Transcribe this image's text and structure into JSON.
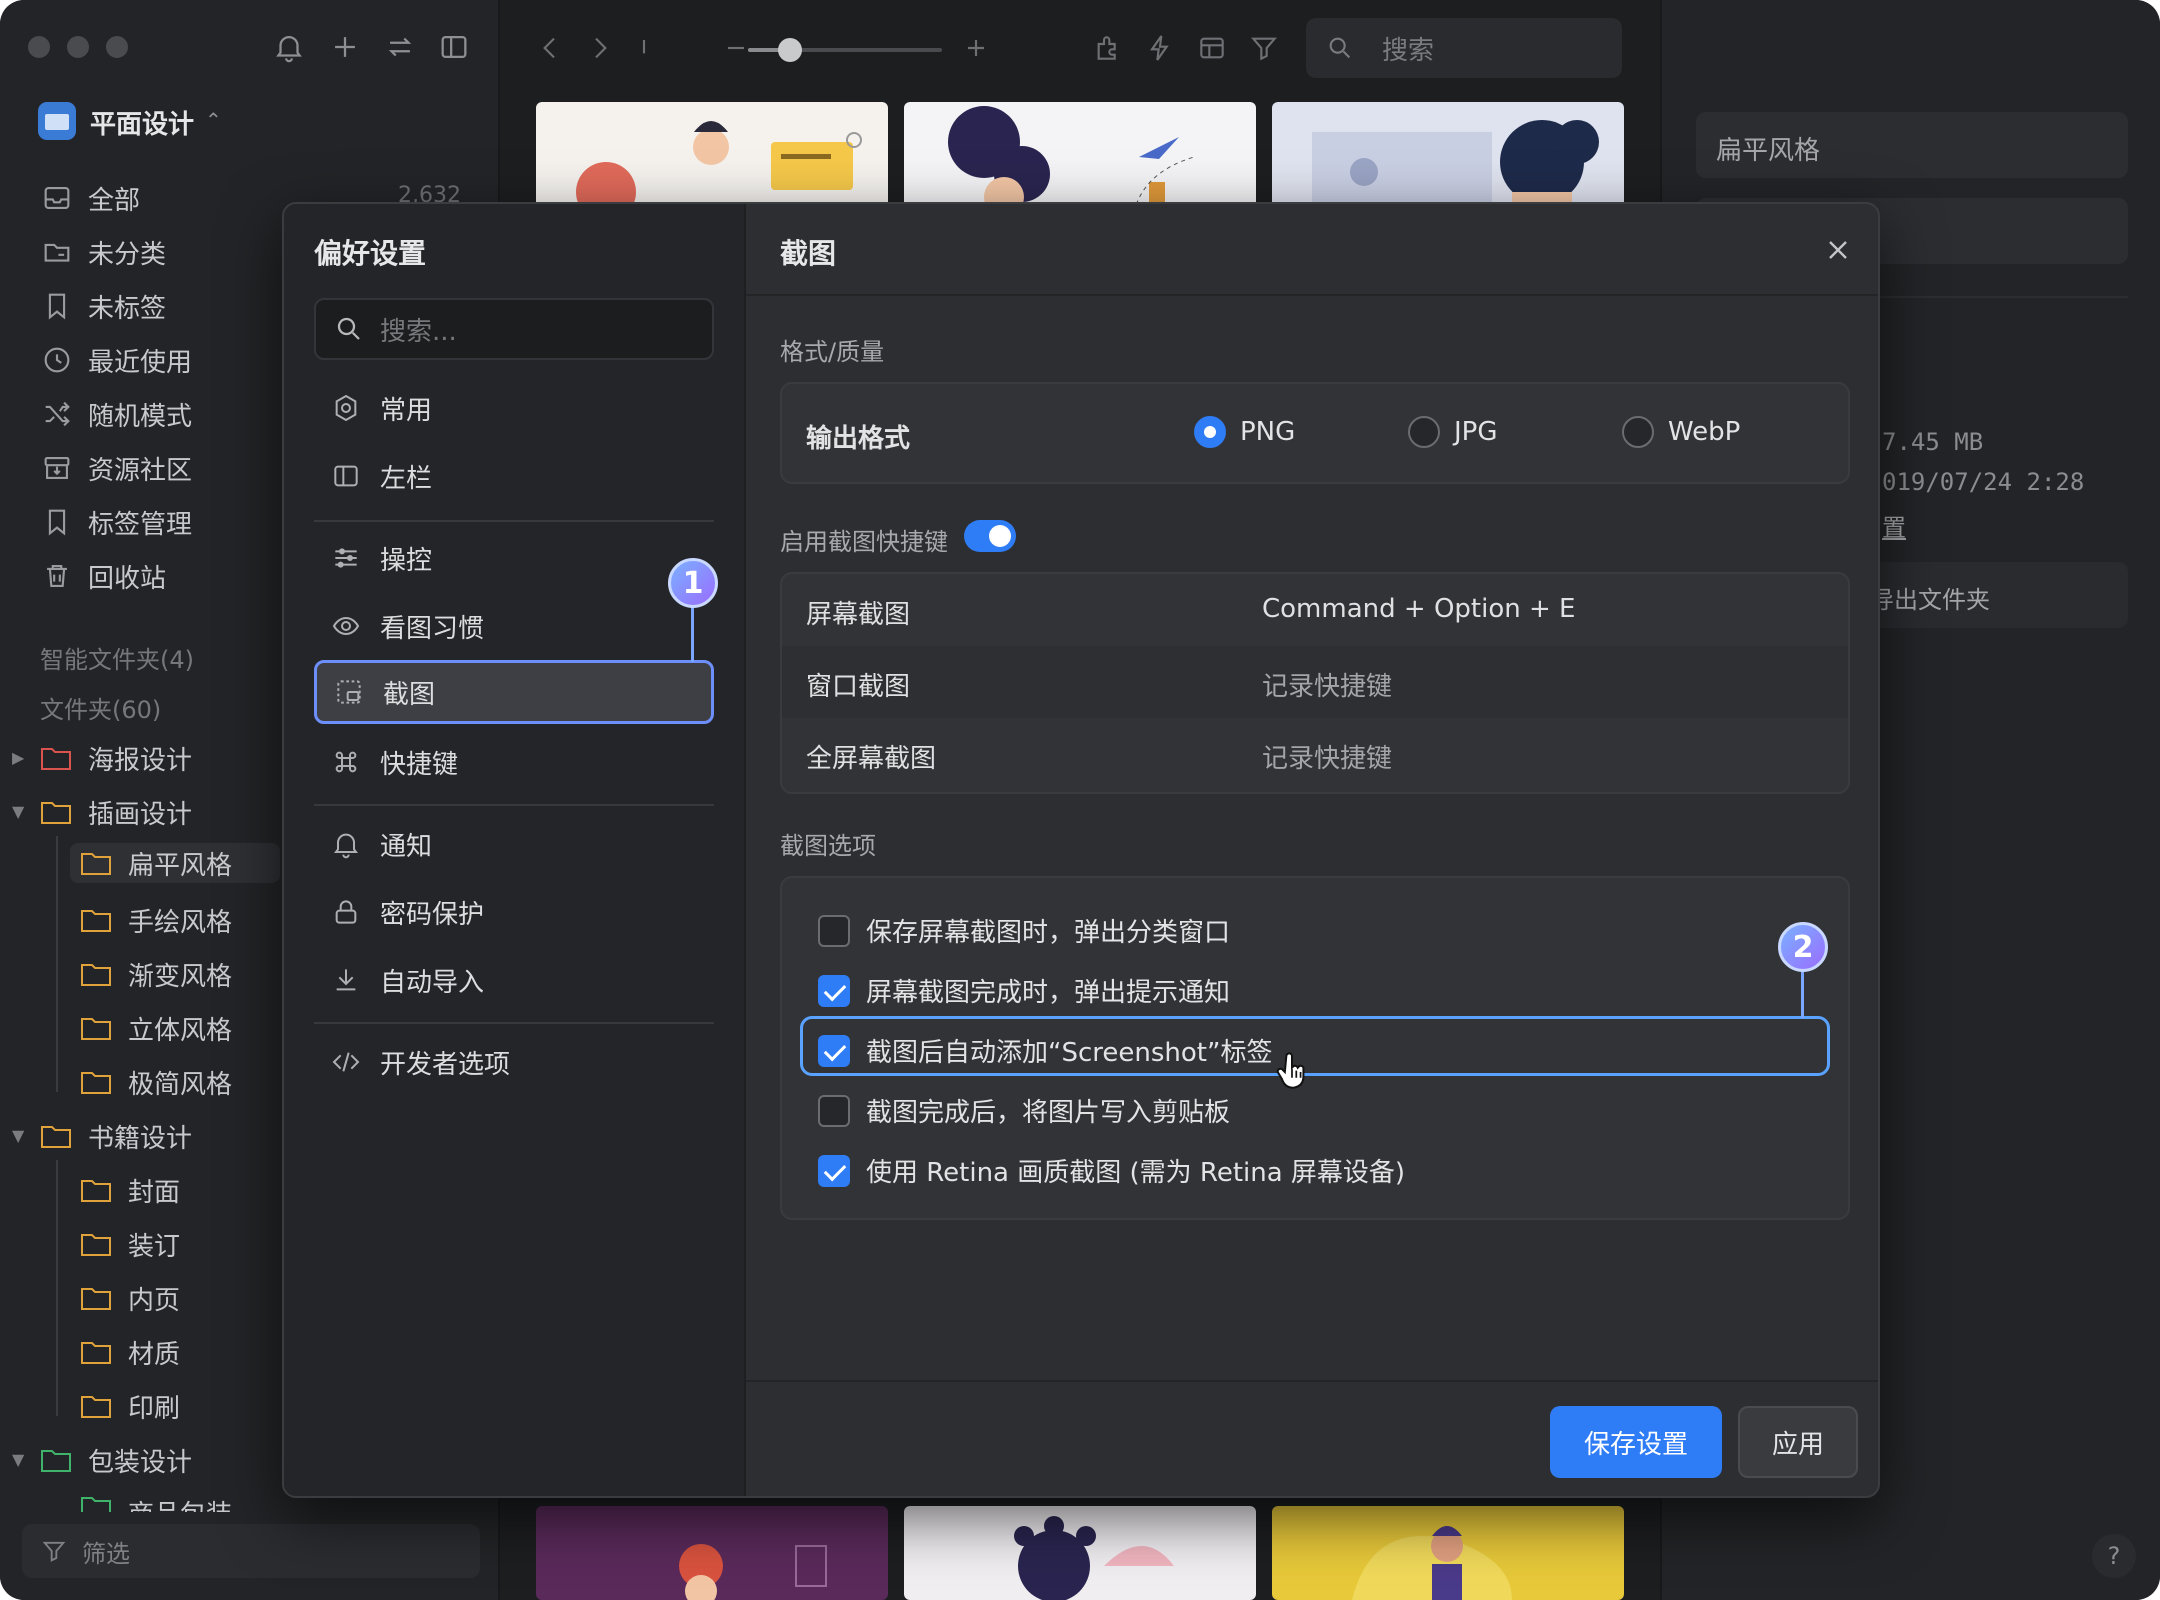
{
  "sidebar": {
    "library_name": "平面设计",
    "items": [
      {
        "label": "全部",
        "icon": "inbox-icon"
      },
      {
        "label": "未分类",
        "icon": "unfiled-icon"
      },
      {
        "label": "未标签",
        "icon": "untagged-icon"
      },
      {
        "label": "最近使用",
        "icon": "clock-icon"
      },
      {
        "label": "随机模式",
        "icon": "shuffle-icon"
      },
      {
        "label": "资源社区",
        "icon": "community-icon"
      },
      {
        "label": "标签管理",
        "icon": "bookmark-icon"
      },
      {
        "label": "回收站",
        "icon": "trash-icon"
      }
    ],
    "all_count": "2,632",
    "smart_folders": "智能文件夹(4)",
    "folders_header": "文件夹(60)",
    "folders": [
      {
        "label": "海报设计",
        "color": "#d9534f"
      },
      {
        "label": "插画设计",
        "color": "#e0a23a"
      },
      {
        "label": "扁平风格",
        "color": "#e0a23a"
      },
      {
        "label": "手绘风格",
        "color": "#e0a23a"
      },
      {
        "label": "渐变风格",
        "color": "#e0a23a"
      },
      {
        "label": "立体风格",
        "color": "#e0a23a"
      },
      {
        "label": "极简风格",
        "color": "#e0a23a"
      },
      {
        "label": "书籍设计",
        "color": "#e0a23a"
      },
      {
        "label": "封面",
        "color": "#e0a23a"
      },
      {
        "label": "装订",
        "color": "#e0a23a"
      },
      {
        "label": "内页",
        "color": "#e0a23a"
      },
      {
        "label": "材质",
        "color": "#e0a23a"
      },
      {
        "label": "印刷",
        "color": "#e0a23a"
      },
      {
        "label": "包装设计",
        "color": "#3fb36a"
      },
      {
        "label": "商品包装",
        "color": "#3fb36a"
      }
    ],
    "filter_label": "筛选"
  },
  "toolbar": {
    "search_placeholder": "搜索",
    "zoom_level": 0.22
  },
  "inspector": {
    "folder_name": "扁平风格",
    "size": "7.45 MB",
    "date": "019/07/24 2:28",
    "link": "置",
    "export": "导出文件夹"
  },
  "dialog": {
    "title": "偏好设置",
    "search_placeholder": "搜索...",
    "nav": [
      {
        "label": "常用",
        "icon": "gear-icon"
      },
      {
        "label": "左栏",
        "icon": "sidebar-icon"
      },
      {
        "label": "操控",
        "icon": "sliders-icon"
      },
      {
        "label": "看图习惯",
        "icon": "eye-icon"
      },
      {
        "label": "截图",
        "icon": "screenshot-icon"
      },
      {
        "label": "快捷键",
        "icon": "command-icon"
      },
      {
        "label": "通知",
        "icon": "bell-icon"
      },
      {
        "label": "密码保护",
        "icon": "lock-icon"
      },
      {
        "label": "自动导入",
        "icon": "download-icon"
      },
      {
        "label": "开发者选项",
        "icon": "code-icon"
      }
    ],
    "callout_1": "1",
    "callout_2": "2",
    "panel_title": "截图",
    "format_section": "格式/质量",
    "output_format_label": "输出格式",
    "formats": [
      "PNG",
      "JPG",
      "WebP"
    ],
    "selected_format": "PNG",
    "shortcut_toggle_label": "启用截图快捷键",
    "shortcut_toggle_on": true,
    "shortcuts": [
      {
        "name": "屏幕截图",
        "value": "Command + Option + E",
        "muted": false
      },
      {
        "name": "窗口截图",
        "value": "记录快捷键",
        "muted": true
      },
      {
        "name": "全屏幕截图",
        "value": "记录快捷键",
        "muted": true
      }
    ],
    "options_section": "截图选项",
    "options": [
      {
        "label": "保存屏幕截图时，弹出分类窗口",
        "checked": false
      },
      {
        "label": "屏幕截图完成时，弹出提示通知",
        "checked": true
      },
      {
        "label": "截图后自动添加“Screenshot”标签",
        "checked": true
      },
      {
        "label": "截图完成后，将图片写入剪贴板",
        "checked": false
      },
      {
        "label": "使用 Retina 画质截图 (需为 Retina 屏幕设备)",
        "checked": true
      }
    ],
    "save_button": "保存设置",
    "apply_button": "应用"
  },
  "help_label": "?"
}
